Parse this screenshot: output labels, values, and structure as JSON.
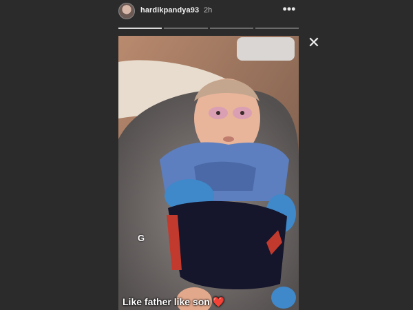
{
  "story": {
    "username": "hardikpandya93",
    "time": "2h",
    "more_icon": "•••",
    "close_icon": "✕",
    "segments": 4,
    "active_segment": 1,
    "sticker_letter": "G",
    "caption": "Like father like son",
    "caption_emoji": "❤️"
  }
}
